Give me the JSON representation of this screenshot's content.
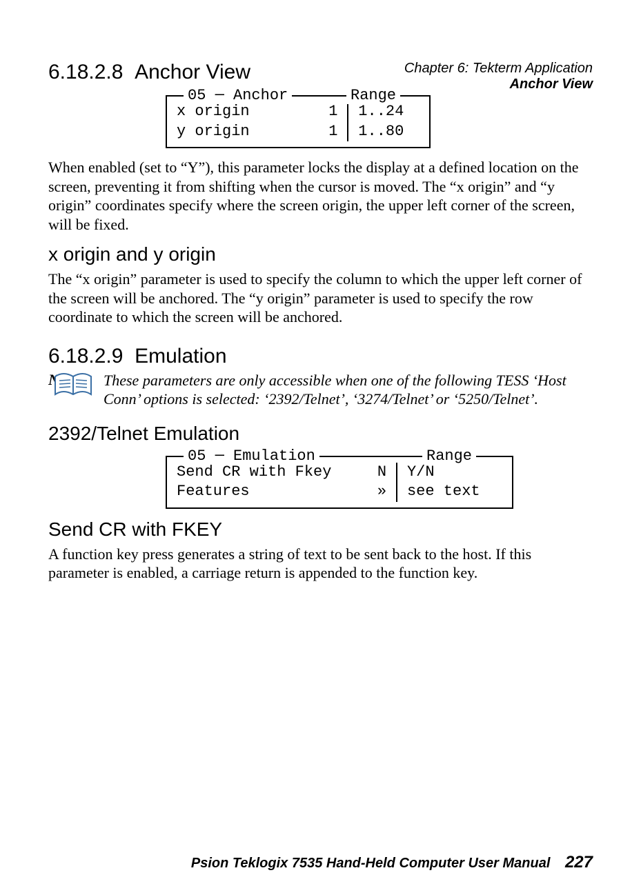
{
  "header": {
    "line1": "Chapter 6: Tekterm Application",
    "line2": "Anchor View"
  },
  "sec1": {
    "num": "6.18.2.8",
    "title": "Anchor View",
    "box": {
      "legend_left": "05",
      "legend_mid": "Anchor",
      "legend_right": "Range",
      "rows": [
        {
          "name": "x origin",
          "val": "1",
          "range": "1..24"
        },
        {
          "name": "y origin",
          "val": "1",
          "range": "1..80"
        }
      ]
    },
    "para1": "When enabled (set to “Y”), this parameter locks the display at a defined location on the screen, preventing it from shifting when the cursor is moved. The “x origin” and “y origin” coordinates specify where the screen origin, the upper left corner of the screen, will be fixed.",
    "sub_heading": "x origin and y origin",
    "para2": "The “x origin” parameter is used to specify the column to which the upper left corner of the screen will be anchored. The “y origin” parameter is used to specify the row coordinate to which the screen will be anchored."
  },
  "sec2": {
    "num": "6.18.2.9",
    "title": "Emulation",
    "note_label": "Note:",
    "note_text": "These parameters are only accessible when one of the following TESS ‘Host Conn’ options is selected: ‘2392/Telnet’, ‘3274/Telnet’ or ‘5250/Telnet’.",
    "sub_heading": "2392/Telnet Emulation",
    "box": {
      "legend_left": "05",
      "legend_mid": "Emulation",
      "legend_right": "Range",
      "rows": [
        {
          "name": "Send CR with Fkey",
          "val": "N",
          "range": "Y/N"
        },
        {
          "name": "Features",
          "val": "»",
          "range": "see text"
        }
      ]
    },
    "sub_heading2": "Send CR with FKEY",
    "para1": "A function key press generates a string of text to be sent back to the host. If this parameter is enabled, a carriage return is appended to the function key."
  },
  "footer": {
    "title": "Psion Teklogix 7535 Hand-Held Computer User Manual",
    "page": "227"
  }
}
